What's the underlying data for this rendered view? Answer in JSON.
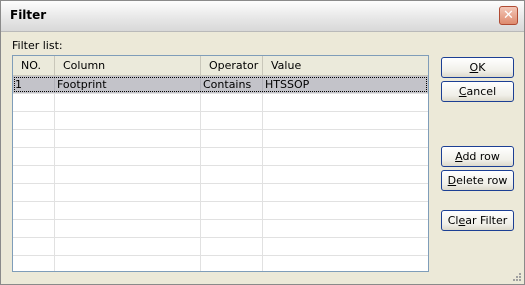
{
  "window": {
    "title": "Filter"
  },
  "filter_list": {
    "label": "Filter list:",
    "columns": [
      "NO.",
      "Column",
      "Operator",
      "Value"
    ],
    "rows": [
      {
        "no": "1",
        "column": "Footprint",
        "operator": "Contains",
        "value": "HTSSOP"
      }
    ]
  },
  "buttons": {
    "ok": {
      "accel": "O",
      "rest": "K"
    },
    "cancel": {
      "accel": "C",
      "rest": "ancel"
    },
    "add_row": {
      "accel": "A",
      "rest": "dd row"
    },
    "delete_row": {
      "accel": "D",
      "rest": "elete row"
    },
    "clear_filter": {
      "pre": "Cl",
      "accel": "e",
      "rest": "ar Filter"
    }
  },
  "colors": {
    "selected_row": "#c3c3c9",
    "button_border": "#1c3f94",
    "close_button": "#de8a6e"
  }
}
